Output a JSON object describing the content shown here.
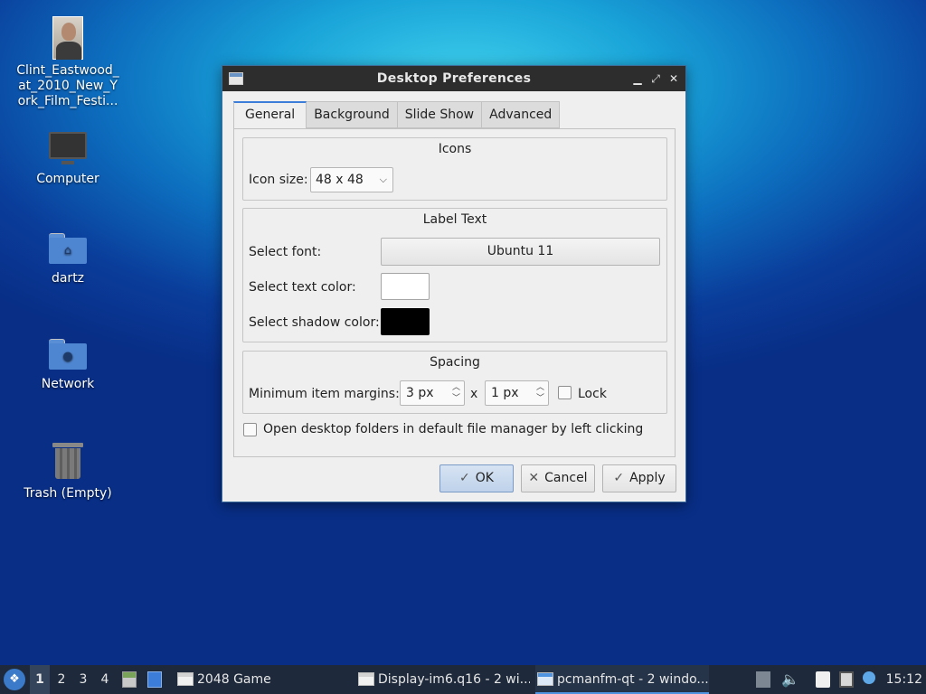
{
  "desktop": {
    "icons": [
      {
        "label": "Clint_Eastwood_\nat_2010_New_Y\nork_Film_Festi..."
      },
      {
        "label": "Computer"
      },
      {
        "label": "dartz"
      },
      {
        "label": "Network"
      },
      {
        "label": "Trash (Empty)"
      }
    ]
  },
  "dialog": {
    "title": "Desktop Preferences",
    "tabs": [
      {
        "label": "General"
      },
      {
        "label": "Background"
      },
      {
        "label": "Slide Show"
      },
      {
        "label": "Advanced"
      }
    ],
    "icons_group": {
      "title": "Icons",
      "icon_size_label": "Icon size:",
      "icon_size_value": "48 x 48"
    },
    "label_text_group": {
      "title": "Label Text",
      "font_label": "Select font:",
      "font_value": "Ubuntu 11",
      "text_color_label": "Select text color:",
      "text_color": "#ffffff",
      "shadow_color_label": "Select shadow color:",
      "shadow_color": "#000000"
    },
    "spacing_group": {
      "title": "Spacing",
      "margins_label": "Minimum item margins:",
      "margin_x": "3 px",
      "separator": "x",
      "margin_y": "1 px",
      "lock_label": "Lock"
    },
    "open_folders_label": "Open desktop folders in default file manager by left clicking",
    "buttons": {
      "ok": "OK",
      "cancel": "Cancel",
      "apply": "Apply"
    }
  },
  "taskbar": {
    "desktops": [
      "1",
      "2",
      "3",
      "4"
    ],
    "tasks": [
      {
        "label": "2048 Game"
      },
      {
        "label": "Display-im6.q16 - 2 wi..."
      },
      {
        "label": "pcmanfm-qt - 2 windo..."
      }
    ],
    "clock": "15:12"
  },
  "colors": {
    "accent": "#3b7dd8",
    "taskbar": "#1e2a3c"
  }
}
